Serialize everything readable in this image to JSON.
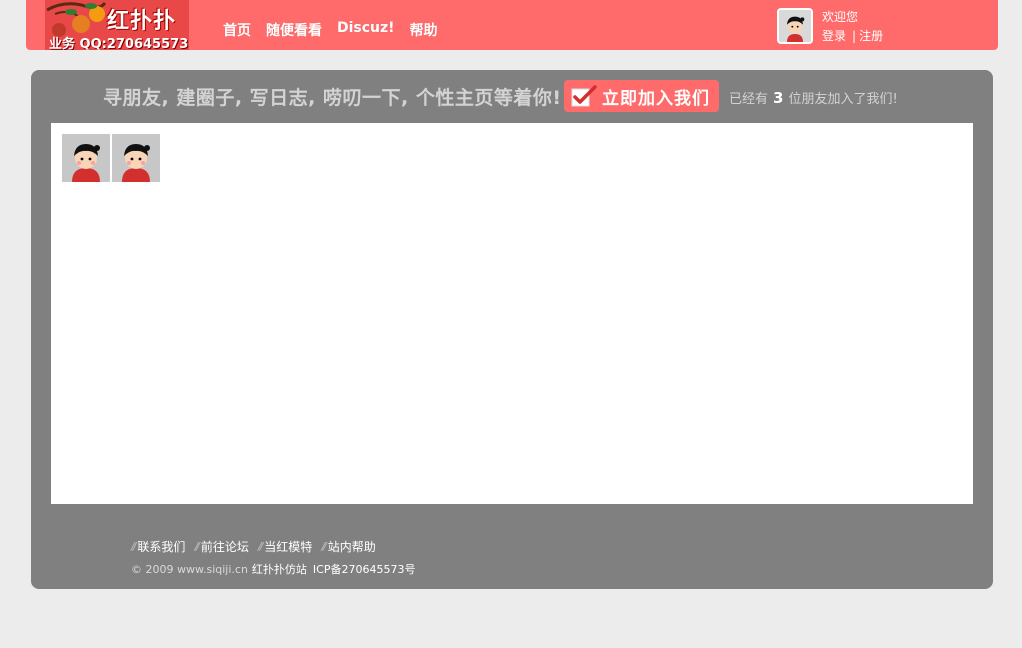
{
  "logo": {
    "title": "红扑扑",
    "qq": "业务 QQ:270645573"
  },
  "nav": {
    "items": [
      "首页",
      "随便看看",
      "Discuz!",
      "帮助"
    ]
  },
  "user": {
    "welcome": "欢迎您",
    "login": "登录",
    "separator": "|",
    "register": "注册"
  },
  "hero": {
    "slogan": "寻朋友, 建圈子, 写日志, 唠叨一下, 个性主页等着你!",
    "join_label": "立即加入我们",
    "members_prefix": "已经有",
    "members_count": "3",
    "members_suffix": "位朋友加入了我们!"
  },
  "footer": {
    "links": [
      "联系我们",
      "前往论坛",
      "当红模特",
      "站内帮助"
    ],
    "copyright": "© 2009 www.siqiji.cn",
    "site_name": "红扑扑仿站",
    "icp": "ICP备270645573号"
  },
  "colors": {
    "header": "#ff6b6b",
    "panel": "#808080",
    "background": "#ececec"
  }
}
